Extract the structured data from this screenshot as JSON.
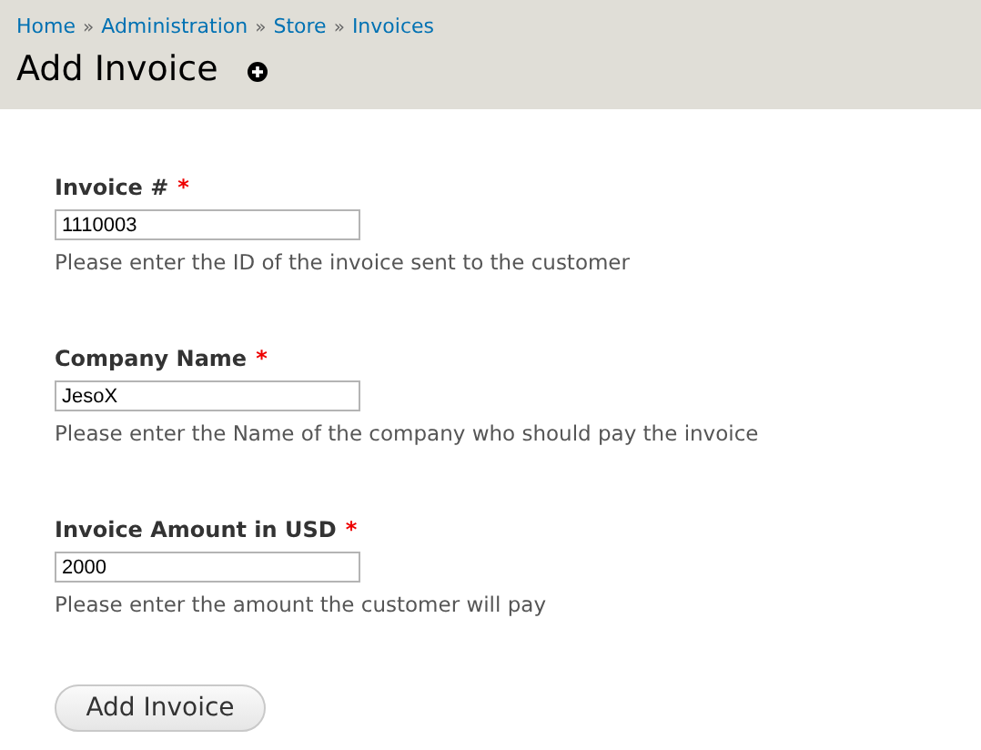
{
  "breadcrumb": {
    "separator": "»",
    "items": [
      {
        "label": "Home"
      },
      {
        "label": "Administration"
      },
      {
        "label": "Store"
      },
      {
        "label": "Invoices"
      }
    ]
  },
  "title": "Add Invoice",
  "fields": [
    {
      "label": "Invoice #",
      "required": true,
      "required_mark": "*",
      "value": "1110003",
      "description": "Please enter the ID of the invoice sent to the customer"
    },
    {
      "label": "Company Name",
      "required": true,
      "required_mark": "*",
      "value": "JesoX",
      "description": "Please enter the Name of the company who should pay the invoice"
    },
    {
      "label": "Invoice Amount in USD",
      "required": true,
      "required_mark": "*",
      "value": "2000",
      "description": "Please enter the amount the customer will pay"
    }
  ],
  "submit": "Add Invoice"
}
